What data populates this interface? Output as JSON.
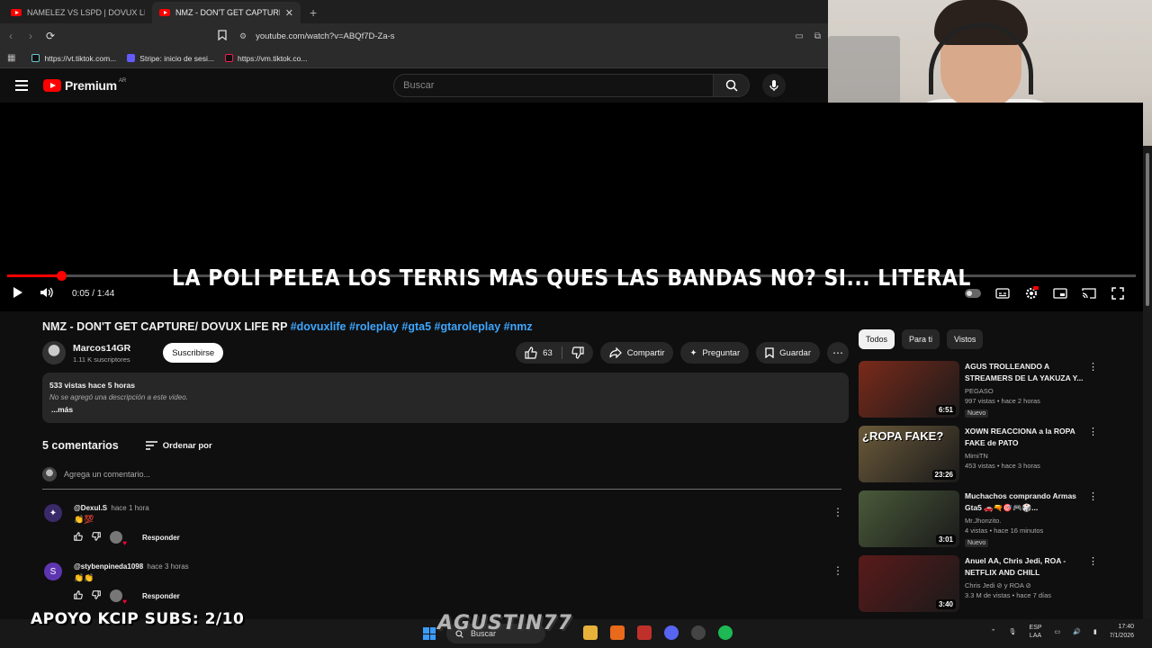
{
  "browser": {
    "tabs": [
      {
        "title": "NAMELEZ VS LSPD | DOVUX LIFE - Yo",
        "active": false
      },
      {
        "title": "NMZ - DON'T GET CAPTURE/ D",
        "active": true
      }
    ],
    "url": "youtube.com/watch?v=ABQf7D-Za-s",
    "bookmarks": [
      {
        "label": "https://vt.tiktok.com...",
        "icon": "tiktok-icon"
      },
      {
        "label": "Stripe: inicio de sesi...",
        "icon": "stripe-icon"
      },
      {
        "label": "https://vm.tiktok.co...",
        "icon": "tiktok-icon"
      }
    ]
  },
  "header": {
    "logo_text": "Premium",
    "region": "AR",
    "search_placeholder": "Buscar"
  },
  "player": {
    "caption": "LA POLI PELEA LOS TERRIS MAS QUES LAS BANDAS NO? SI... LITERAL",
    "time_current": "0:05",
    "time_total": "1:44",
    "progress": 0.048
  },
  "video": {
    "title": "NMZ - DON'T GET CAPTURE/ DOVUX LIFE RP",
    "hashtags": [
      "#dovuxlife",
      "#roleplay",
      "#gta5",
      "#gtaroleplay",
      "#nmz"
    ],
    "channel": "Marcos14GR",
    "subscribers": "1.11 K suscriptores",
    "subscribe_label": "Suscribirse",
    "likes": "63",
    "share_label": "Compartir",
    "ask_label": "Preguntar",
    "save_label": "Guardar",
    "views_age": "533 vistas  hace 5 horas",
    "description": "No se agregó una descripción a este video.",
    "more_label": "...más"
  },
  "comments": {
    "count_label": "5 comentarios",
    "sort_label": "Ordenar por",
    "add_placeholder": "Agrega un comentario...",
    "reply_label": "Responder",
    "items": [
      {
        "user": "@Dexul.S",
        "time": "hace 1 hora",
        "text": "👏💯",
        "avatar_color": "#3b2a6a",
        "avatar_letter": "✦"
      },
      {
        "user": "@stybenpineda1098",
        "time": "hace 3 horas",
        "text": "👏👏",
        "avatar_color": "#5e35b1",
        "avatar_letter": "S"
      }
    ]
  },
  "sidebar": {
    "chips": [
      "Todos",
      "Para ti",
      "Vistos"
    ],
    "recommendations": [
      {
        "title": "AGUS TROLLEANDO A STREAMERS DE LA YAKUZA Y...",
        "channel": "PEGASO",
        "meta": "997 vistas • hace 2 horas",
        "badge": "Nuevo",
        "duration": "6:51",
        "thumb_text": "",
        "thumb_color": "#7a2a1a"
      },
      {
        "title": "XOWN REACCIONA a la ROPA FAKE de PATO",
        "channel": "MimiTN",
        "meta": "453 vistas • hace 3 horas",
        "badge": "",
        "duration": "23:26",
        "thumb_text": "¿ROPA FAKE?",
        "thumb_color": "#6b5a3a"
      },
      {
        "title": "Muchachos comprando Armas Gta5 🚗🔫🎯🎮🎲...",
        "channel": "Mr.Jhonzito.",
        "meta": "4 vistas • hace 16 minutos",
        "badge": "Nuevo",
        "duration": "3:01",
        "thumb_text": "",
        "thumb_color": "#4a5a3a"
      },
      {
        "title": "Anuel AA, Chris Jedi, ROA - NETFLIX AND CHILL",
        "channel": "Chris Jedi ⊘ y ROA ⊘",
        "meta": "3.3 M de vistas • hace 7 días",
        "badge": "",
        "duration": "3:40",
        "thumb_text": "",
        "thumb_color": "#5a1a1a"
      }
    ]
  },
  "overlay": {
    "apoyo": "APOYO KCIP SUBS: 2/10",
    "streamer_logo": "AGUSTIN77"
  },
  "taskbar": {
    "search_label": "Buscar",
    "lang_top": "ESP",
    "lang_bottom": "LAA",
    "time": "17:40",
    "date": "7/1/2026"
  }
}
